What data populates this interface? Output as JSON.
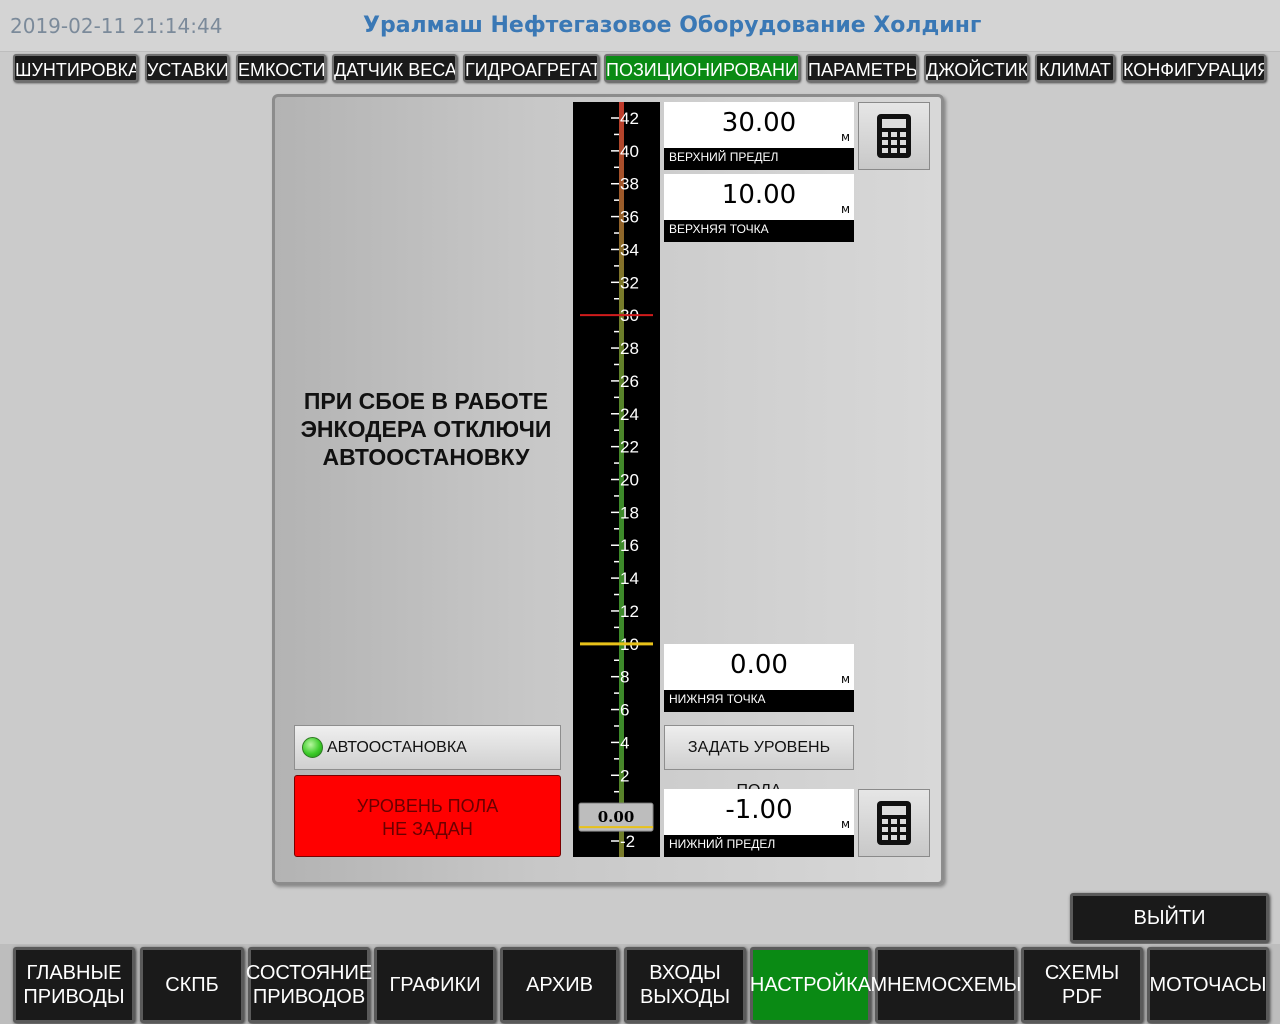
{
  "header": {
    "datetime": "2019-02-11 21:14:44",
    "title": "Уралмаш Нефтегазовое Оборудование Холдинг"
  },
  "tabs": [
    {
      "label": "ШУНТИРОВКА",
      "active": false
    },
    {
      "label": "УСТАВКИ",
      "active": false
    },
    {
      "label": "ЕМКОСТИ",
      "active": false
    },
    {
      "label": "ДАТЧИК ВЕСА",
      "active": false
    },
    {
      "label": "ГИДРОАГРЕГАТ",
      "active": false
    },
    {
      "label": "ПОЗИЦИОНИРОВАНИЕ",
      "active": true
    },
    {
      "label": "ПАРАМЕТРЫ",
      "active": false
    },
    {
      "label": "ДЖОЙСТИК",
      "active": false
    },
    {
      "label": "КЛИМАТ",
      "active": false
    },
    {
      "label": "КОНФИГУРАЦИЯ",
      "active": false
    }
  ],
  "panel": {
    "warning_line1": "ПРИ СБОЕ В РАБОТЕ",
    "warning_line2": "ЭНКОДЕРА ОТКЛЮЧИ",
    "warning_line3": "АВТООСТАНОВКУ",
    "scale": {
      "min": -3,
      "max": 43,
      "tick_labels": [
        "42",
        "40",
        "38",
        "36",
        "34",
        "32",
        "30",
        "28",
        "26",
        "24",
        "22",
        "20",
        "18",
        "16",
        "14",
        "12",
        "10",
        "8",
        "6",
        "4",
        "2",
        "-2"
      ],
      "current_value": "0.00",
      "upper_limit_marker": 30,
      "upper_point_marker": 10,
      "lower_limit_marker": -1
    },
    "upper_limit": {
      "value": "30.00",
      "unit": "м",
      "label": "ВЕРХНИЙ ПРЕДЕЛ"
    },
    "upper_point": {
      "value": "10.00",
      "unit": "м",
      "label": "ВЕРХНЯЯ ТОЧКА"
    },
    "lower_point": {
      "value": "0.00",
      "unit": "м",
      "label": "НИЖНЯЯ ТОЧКА"
    },
    "lower_limit": {
      "value": "-1.00",
      "unit": "м",
      "label": "НИЖНИЙ ПРЕДЕЛ"
    },
    "set_floor_label": "ЗАДАТЬ УРОВЕНЬ ПОЛА",
    "autostop_label": "АВТООСТАНОВКА",
    "autostop_led_color": "#3dcc2a",
    "alarm_line1": "УРОВЕНЬ ПОЛА",
    "alarm_line2": "НЕ ЗАДАН",
    "alarm_color": "#ff0000"
  },
  "exit_label": "ВЫЙТИ",
  "bottom_nav": [
    {
      "label": "ГЛАВНЫЕ\nПРИВОДЫ",
      "active": false
    },
    {
      "label": "СКПБ",
      "active": false
    },
    {
      "label": "СОСТОЯНИЕ\nПРИВОДОВ",
      "active": false
    },
    {
      "label": "ГРАФИКИ",
      "active": false
    },
    {
      "label": "АРХИВ",
      "active": false
    },
    {
      "label": "ВХОДЫ\nВЫХОДЫ",
      "active": false
    },
    {
      "label": "НАСТРОЙКА",
      "active": true
    },
    {
      "label": "МНЕМОСХЕМЫ",
      "active": false
    },
    {
      "label": "СХЕМЫ\nPDF",
      "active": false
    },
    {
      "label": "МОТОЧАСЫ",
      "active": false
    }
  ],
  "colors": {
    "active_green": "#0a8a14",
    "title_blue": "#3a78b5"
  }
}
